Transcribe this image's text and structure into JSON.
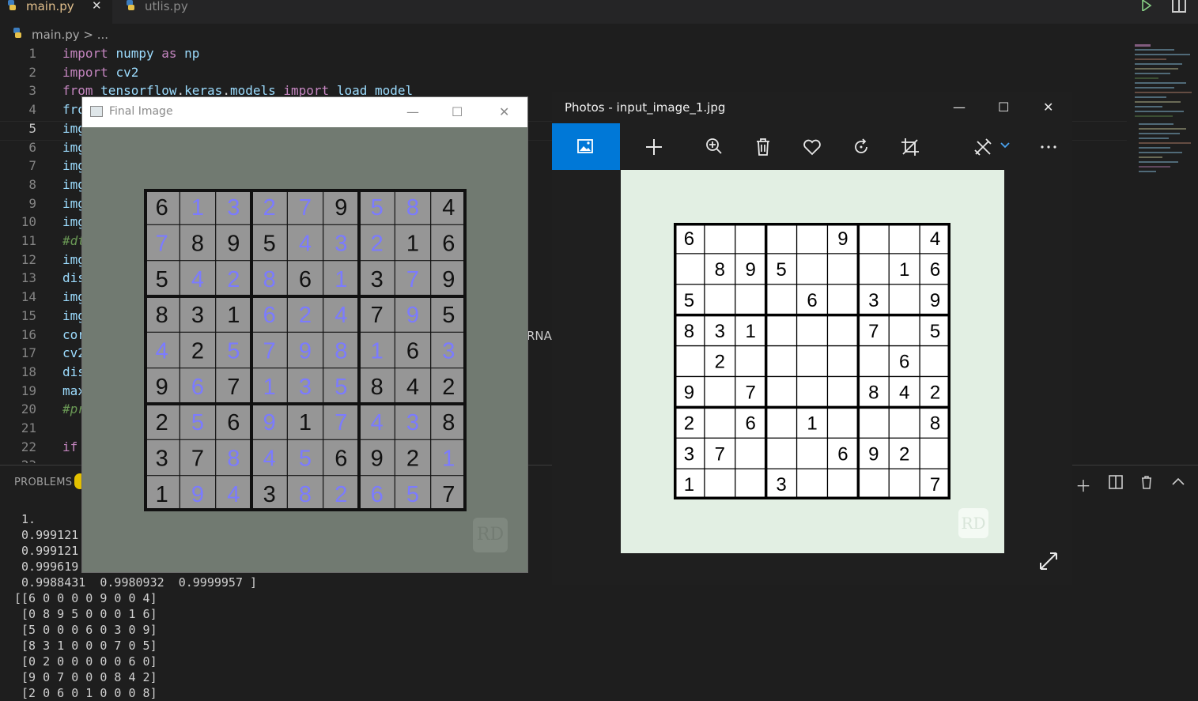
{
  "editor": {
    "tabs": [
      {
        "label": "main.py",
        "active": true
      },
      {
        "label": "utlis.py",
        "active": false
      }
    ],
    "close_glyph": "✕",
    "breadcrumb": "main.py > ...",
    "lines": [
      {
        "n": "1",
        "code": "import numpy as np"
      },
      {
        "n": "2",
        "code": "import cv2"
      },
      {
        "n": "3",
        "code": "from tensorflow.keras.models import load_model"
      },
      {
        "n": "4",
        "code": "fro"
      },
      {
        "n": "5",
        "code": "img"
      },
      {
        "n": "6",
        "code": "img"
      },
      {
        "n": "7",
        "code": "img"
      },
      {
        "n": "8",
        "code": "img"
      },
      {
        "n": "9",
        "code": "img"
      },
      {
        "n": "10",
        "code": "img"
      },
      {
        "n": "11",
        "code": "#dt"
      },
      {
        "n": "12",
        "code": "img"
      },
      {
        "n": "13",
        "code": "dis"
      },
      {
        "n": "14",
        "code": "img"
      },
      {
        "n": "15",
        "code": "img"
      },
      {
        "n": "16",
        "code": "cor"
      },
      {
        "n": "17",
        "code": "cv2"
      },
      {
        "n": "18",
        "code": "dis"
      },
      {
        "n": "19",
        "code": "max"
      },
      {
        "n": "20",
        "code": "#pr"
      },
      {
        "n": "21",
        "code": ""
      },
      {
        "n": "22",
        "code": "if"
      },
      {
        "n": "23",
        "code": ""
      }
    ],
    "current_line": "5"
  },
  "panel": {
    "problems_label": "PROBLEMS",
    "truncated_tab": "RNAI",
    "output": [
      " 1.",
      " 0.999121",
      " 0.999121",
      " 0.999619",
      " 0.9988431  0.9980932  0.9999957 ]",
      "[[6 0 0 0 0 9 0 0 4]",
      " [0 8 9 5 0 0 0 1 6]",
      " [5 0 0 0 6 0 3 0 9]",
      " [8 3 1 0 0 0 7 0 5]",
      " [0 2 0 0 0 0 0 6 0]",
      " [9 0 7 0 0 0 8 4 2]",
      " [2 0 6 0 1 0 0 0 8]"
    ]
  },
  "final_window": {
    "title": "Final Image",
    "minimize": "—",
    "maximize": "☐",
    "close": "✕",
    "watermark": "RD",
    "colors": {
      "given": "#111111",
      "solved": "#7b7bff",
      "cell": "#969696",
      "bg": "#717a71"
    }
  },
  "photos_window": {
    "title": "Photos - input_image_1.jpg",
    "minimize": "—",
    "maximize": "☐",
    "close": "✕",
    "watermark": "RD",
    "toolbar_icons": [
      "image-icon",
      "add-icon",
      "zoom-in-icon",
      "delete-icon",
      "favorite-icon",
      "rotate-icon",
      "crop-icon",
      "edit-icon",
      "more-icon"
    ]
  },
  "sudoku": {
    "given": [
      [
        6,
        0,
        0,
        0,
        0,
        9,
        0,
        0,
        4
      ],
      [
        0,
        8,
        9,
        5,
        0,
        0,
        0,
        1,
        6
      ],
      [
        5,
        0,
        0,
        0,
        6,
        0,
        3,
        0,
        9
      ],
      [
        8,
        3,
        1,
        0,
        0,
        0,
        7,
        0,
        5
      ],
      [
        0,
        2,
        0,
        0,
        0,
        0,
        0,
        6,
        0
      ],
      [
        9,
        0,
        7,
        0,
        0,
        0,
        8,
        4,
        2
      ],
      [
        2,
        0,
        6,
        0,
        1,
        0,
        0,
        0,
        8
      ],
      [
        3,
        7,
        0,
        0,
        0,
        6,
        9,
        2,
        0
      ],
      [
        1,
        0,
        0,
        3,
        0,
        0,
        0,
        0,
        7
      ]
    ],
    "solved": [
      [
        6,
        1,
        3,
        2,
        7,
        9,
        5,
        8,
        4
      ],
      [
        7,
        8,
        9,
        5,
        4,
        3,
        2,
        1,
        6
      ],
      [
        5,
        4,
        2,
        8,
        6,
        1,
        3,
        7,
        9
      ],
      [
        8,
        3,
        1,
        6,
        2,
        4,
        7,
        9,
        5
      ],
      [
        4,
        2,
        5,
        7,
        9,
        8,
        1,
        6,
        3
      ],
      [
        9,
        6,
        7,
        1,
        3,
        5,
        8,
        4,
        2
      ],
      [
        2,
        5,
        6,
        9,
        1,
        7,
        4,
        3,
        8
      ],
      [
        3,
        7,
        8,
        4,
        5,
        6,
        9,
        2,
        1
      ],
      [
        1,
        9,
        4,
        3,
        8,
        2,
        6,
        5,
        7
      ]
    ]
  }
}
